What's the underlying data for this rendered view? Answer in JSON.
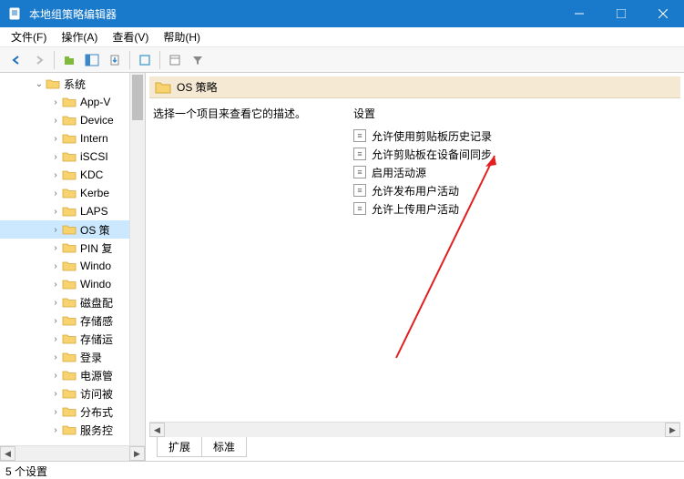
{
  "window": {
    "title": "本地组策略编辑器"
  },
  "menu": {
    "file": "文件(F)",
    "action": "操作(A)",
    "view": "查看(V)",
    "help": "帮助(H)"
  },
  "tree": {
    "root": "系统",
    "items": [
      "App-V",
      "Device",
      "Intern",
      "iSCSI",
      "KDC",
      "Kerbe",
      "LAPS",
      "OS 策",
      "PIN 复",
      "Windo",
      "Windo",
      "磁盘配",
      "存储感",
      "存储运",
      "登录",
      "电源管",
      "访问被",
      "分布式",
      "服务控"
    ],
    "selected_index": 7
  },
  "detail": {
    "header": "OS 策略",
    "description": "选择一个项目来查看它的描述。",
    "settings_label": "设置",
    "settings": [
      "允许使用剪贴板历史记录",
      "允许剪贴板在设备间同步",
      "启用活动源",
      "允许发布用户活动",
      "允许上传用户活动"
    ]
  },
  "tabs": {
    "extended": "扩展",
    "standard": "标准"
  },
  "status": {
    "text": "5 个设置"
  }
}
